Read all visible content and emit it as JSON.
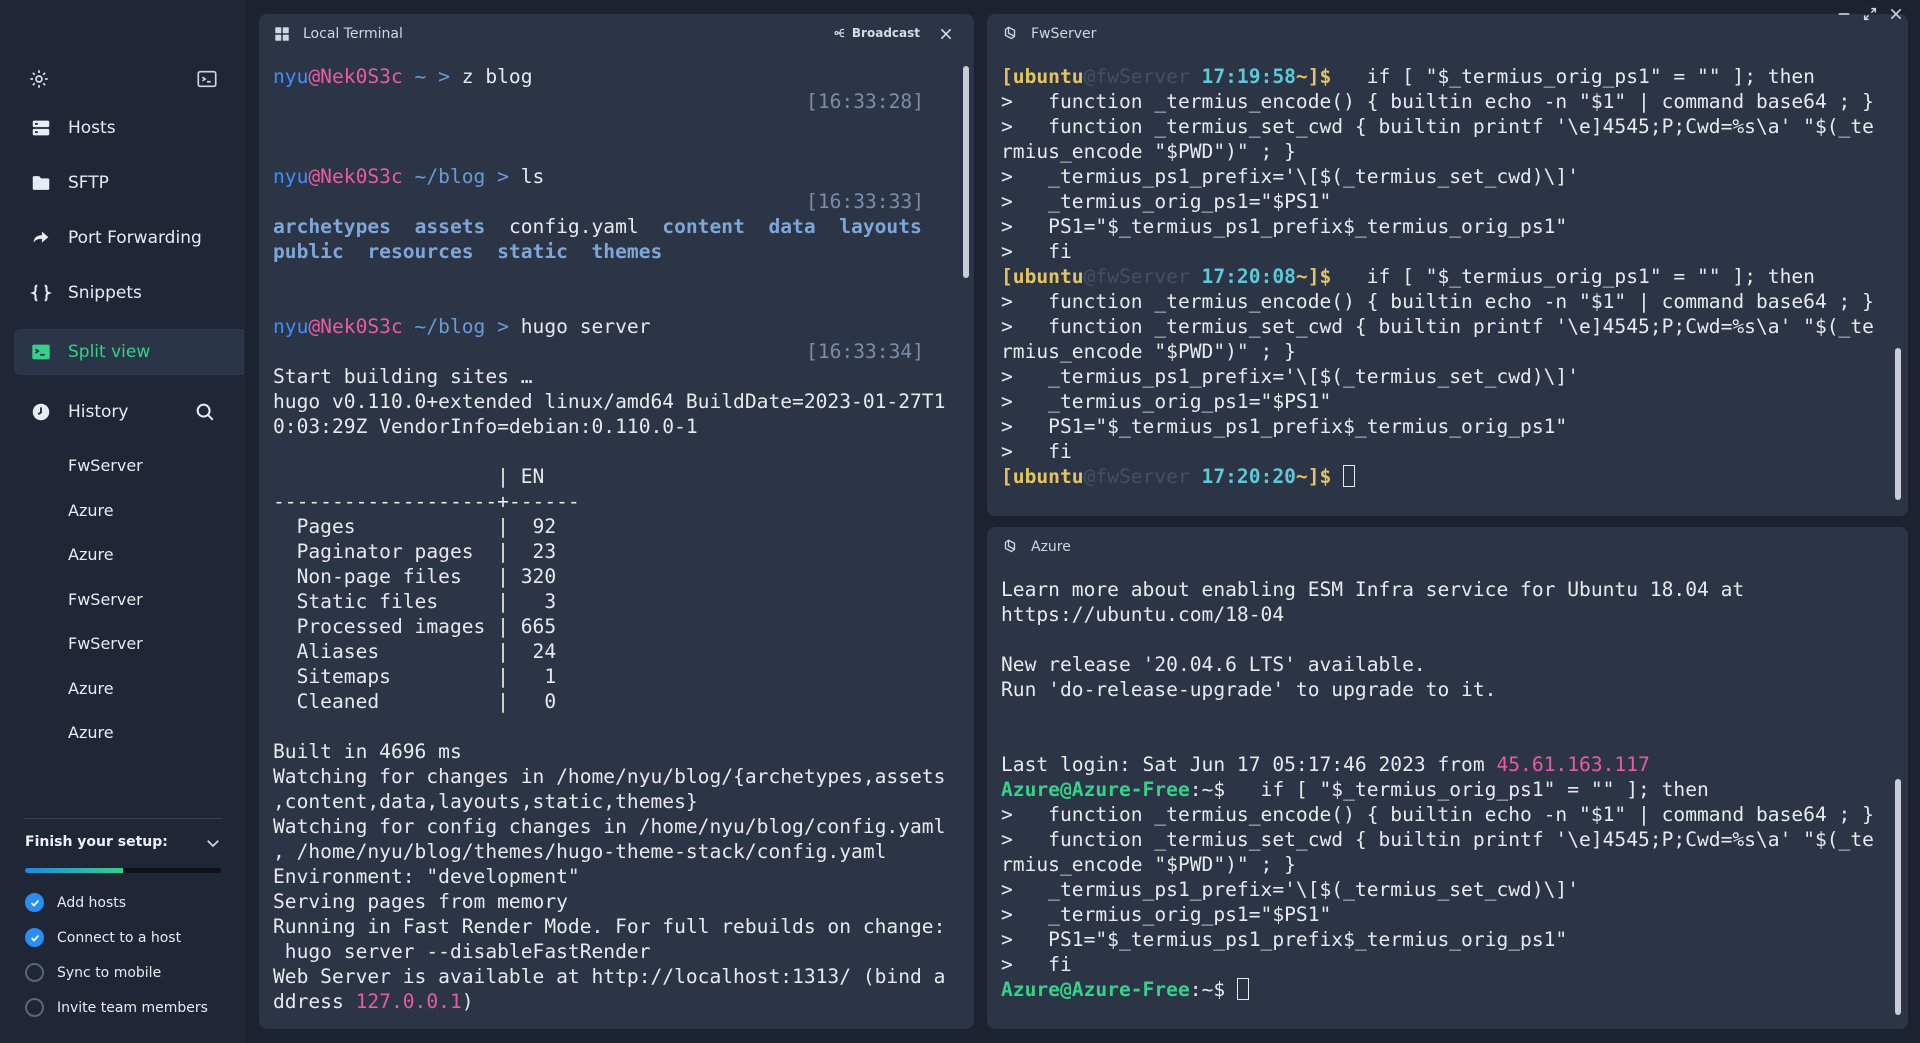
{
  "sidebar": {
    "nav": [
      {
        "label": "Hosts",
        "icon": "hosts-icon"
      },
      {
        "label": "SFTP",
        "icon": "folder-icon"
      },
      {
        "label": "Port Forwarding",
        "icon": "port-forward-icon"
      },
      {
        "label": "Snippets",
        "icon": "snippets-icon"
      },
      {
        "label": "Split view",
        "icon": "split-view-icon"
      }
    ],
    "history_label": "History",
    "history": [
      "FwServer",
      "Azure",
      "Azure",
      "FwServer",
      "FwServer",
      "Azure",
      "Azure"
    ],
    "setup": {
      "title": "Finish your setup:",
      "progress": 0.5,
      "items": [
        {
          "label": "Add hosts",
          "done": true
        },
        {
          "label": "Connect to a host",
          "done": true
        },
        {
          "label": "Sync to mobile",
          "done": false
        },
        {
          "label": "Invite team members",
          "done": false
        }
      ]
    }
  },
  "colors": {
    "accent": "#35d08a",
    "check": "#2a8cf5"
  },
  "local": {
    "title": "Local Terminal",
    "broadcast": "Broadcast",
    "user": "nyu",
    "host": "Nek0S3c",
    "cmd1": {
      "path": "~",
      "cmd": "z",
      "arg": "blog",
      "time": "[16:33:28]"
    },
    "cmd2": {
      "path": "~/blog",
      "cmd": "ls",
      "time": "[16:33:33]"
    },
    "ls_row1": [
      "archetypes",
      "assets",
      "config.yaml",
      "content",
      "data",
      "layouts"
    ],
    "ls_row2": [
      "public",
      "resources",
      "static",
      "themes"
    ],
    "cmd3": {
      "path": "~/blog",
      "cmd": "hugo",
      "arg": "server",
      "time": "[16:33:34]"
    },
    "output": [
      "Start building sites … ",
      "hugo v0.110.0+extended linux/amd64 BuildDate=2023-01-27T1",
      "0:03:29Z VendorInfo=debian:0.110.0-1",
      "",
      "                   | EN  ",
      "-------------------+------",
      "  Pages            |  92  ",
      "  Paginator pages  |  23  ",
      "  Non-page files   | 320  ",
      "  Static files     |   3  ",
      "  Processed images | 665  ",
      "  Aliases          |  24  ",
      "  Sitemaps         |   1  ",
      "  Cleaned          |   0  ",
      "",
      "Built in 4696 ms",
      "Watching for changes in /home/nyu/blog/{archetypes,assets",
      ",content,data,layouts,static,themes}",
      "Watching for config changes in /home/nyu/blog/config.yaml",
      ", /home/nyu/blog/themes/hugo-theme-stack/config.yaml",
      "Environment: \"development\"",
      "Serving pages from memory",
      "Running in Fast Render Mode. For full rebuilds on change:",
      " hugo server --disableFastRender",
      "Web Server is available at http://localhost:1313/ (bind a",
      "ddress "
    ],
    "bind_ip": "127.0.0.1",
    "bind_close": ")"
  },
  "fw": {
    "title": "FwServer",
    "ubuntu": "[ubuntu",
    "faint": "@fwServer",
    "times": [
      "17:19:58",
      "17:20:08",
      "17:20:20"
    ],
    "suffix": "~]$",
    "if_line": "   if [ \"$_termius_orig_ps1\" = \"\" ]; then",
    "body": [
      ">   function _termius_encode() { builtin echo -n \"$1\" | command base64 ; }",
      ">   function _termius_set_cwd { builtin printf '\\e]4545;P;Cwd=%s\\a' \"$(_te",
      "rmius_encode \"$PWD\")\" ; }",
      ">   _termius_ps1_prefix='\\[$(_termius_set_cwd)\\]'",
      ">   _termius_orig_ps1=\"$PS1\"",
      ">   PS1=\"$_termius_ps1_prefix$_termius_orig_ps1\"",
      ">   fi"
    ]
  },
  "azure": {
    "title": "Azure",
    "motd": [
      "Learn more about enabling ESM Infra service for Ubuntu 18.04 at",
      "https://ubuntu.com/18-04",
      "",
      "New release '20.04.6 LTS' available.",
      "Run 'do-release-upgrade' to upgrade to it.",
      "",
      ""
    ],
    "last_login": "Last login: Sat Jun 17 05:17:46 2023 from ",
    "ip": "45.61.163.117",
    "prompt_user": "Azure@Azure-Free",
    "prompt_rest": ":~$",
    "if_line": "   if [ \"$_termius_orig_ps1\" = \"\" ]; then",
    "body": [
      ">   function _termius_encode() { builtin echo -n \"$1\" | command base64 ; }",
      ">   function _termius_set_cwd { builtin printf '\\e]4545;P;Cwd=%s\\a' \"$(_te",
      "rmius_encode \"$PWD\")\" ; }",
      ">   _termius_ps1_prefix='\\[$(_termius_set_cwd)\\]'",
      ">   _termius_orig_ps1=\"$PS1\"",
      ">   PS1=\"$_termius_ps1_prefix$_termius_orig_ps1\"",
      ">   fi"
    ]
  }
}
